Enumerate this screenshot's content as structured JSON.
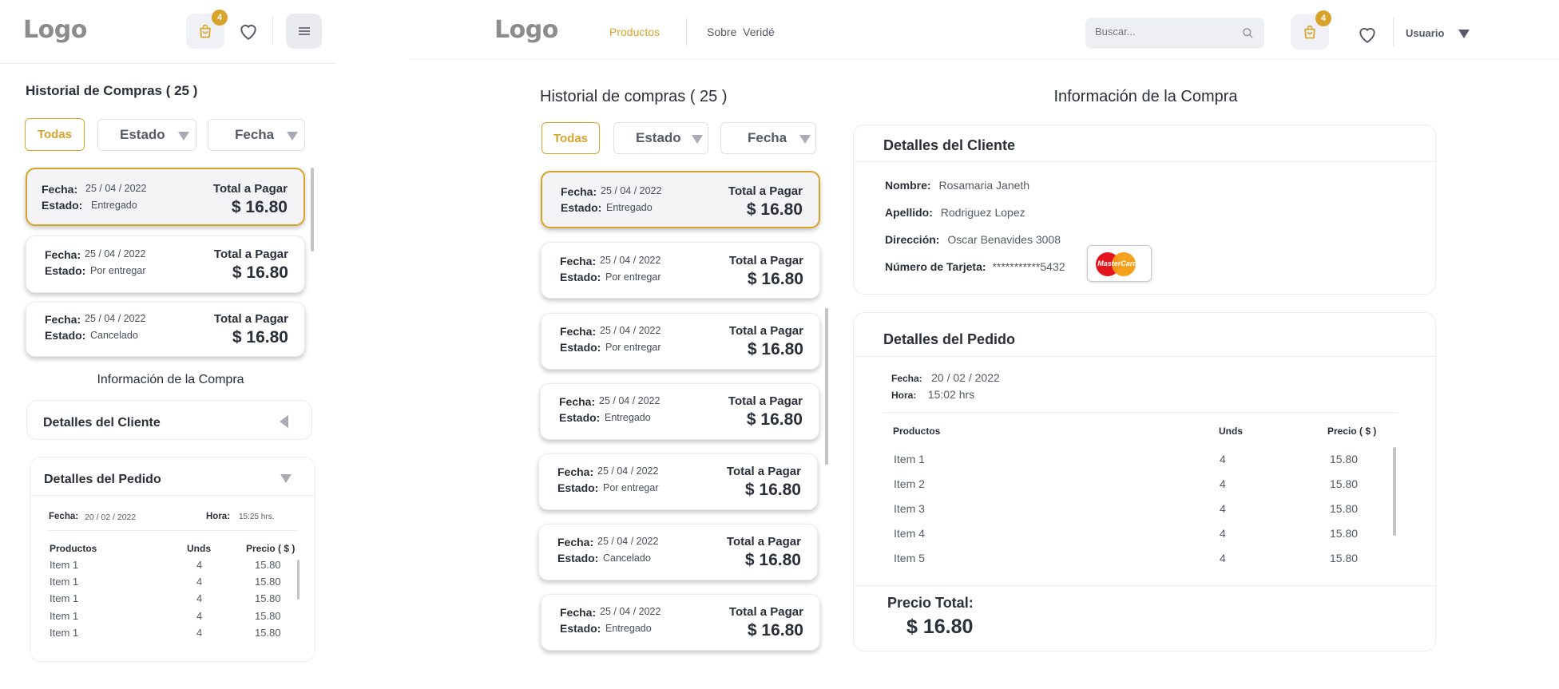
{
  "mobile": {
    "logo": "Logo",
    "cart_badge": "4",
    "history_title": "Historial de Compras ( 25 )",
    "filters": {
      "all": "Todas",
      "status": "Estado",
      "date": "Fecha"
    },
    "orders": [
      {
        "date_label": "Fecha:",
        "date": "25 / 04 / 2022",
        "status_label": "Estado:",
        "status": "Entregado",
        "total_label": "Total a Pagar",
        "amount": "$ 16.80"
      },
      {
        "date_label": "Fecha:",
        "date": "25 / 04 / 2022",
        "status_label": "Estado:",
        "status": "Por entregar",
        "total_label": "Total a Pagar",
        "amount": "$ 16.80"
      },
      {
        "date_label": "Fecha:",
        "date": "25 / 04 / 2022",
        "status_label": "Estado:",
        "status": "Cancelado",
        "total_label": "Total a Pagar",
        "amount": "$ 16.80"
      }
    ],
    "info_title": "Información de la Compra",
    "client_title": "Detalles del Cliente",
    "order_title": "Detalles del Pedido",
    "date_label": "Fecha:",
    "date": "20 / 02 / 2022",
    "time_label": "Hora:",
    "time": "15:25 hrs.",
    "col_products": "Productos",
    "col_units": "Unds",
    "col_price": "Precio ( $ )",
    "items": [
      {
        "name": "Item 1",
        "units": "4",
        "price": "15.80"
      },
      {
        "name": "Item 1",
        "units": "4",
        "price": "15.80"
      },
      {
        "name": "Item 1",
        "units": "4",
        "price": "15.80"
      },
      {
        "name": "Item 1",
        "units": "4",
        "price": "15.80"
      },
      {
        "name": "Item 1",
        "units": "4",
        "price": "15.80"
      }
    ]
  },
  "desktop": {
    "logo": "Logo",
    "nav": {
      "products": "Productos",
      "about": "Sobre  Veridé"
    },
    "search_placeholder": "Buscar...",
    "cart_badge": "4",
    "user": "Usuario",
    "history_title": "Historial de compras ( 25 )",
    "filters": {
      "all": "Todas",
      "status": "Estado",
      "date": "Fecha"
    },
    "orders": [
      {
        "date_label": "Fecha:",
        "date": "25 / 04 / 2022",
        "status_label": "Estado:",
        "status": "Entregado",
        "total_label": "Total a Pagar",
        "amount": "$ 16.80"
      },
      {
        "date_label": "Fecha:",
        "date": "25 / 04 / 2022",
        "status_label": "Estado:",
        "status": "Por entregar",
        "total_label": "Total a Pagar",
        "amount": "$ 16.80"
      },
      {
        "date_label": "Fecha:",
        "date": "25 / 04 / 2022",
        "status_label": "Estado:",
        "status": "Por entregar",
        "total_label": "Total a Pagar",
        "amount": "$ 16.80"
      },
      {
        "date_label": "Fecha:",
        "date": "25 / 04 / 2022",
        "status_label": "Estado:",
        "status": "Entregado",
        "total_label": "Total a Pagar",
        "amount": "$ 16.80"
      },
      {
        "date_label": "Fecha:",
        "date": "25 / 04 / 2022",
        "status_label": "Estado:",
        "status": "Por entregar",
        "total_label": "Total a Pagar",
        "amount": "$ 16.80"
      },
      {
        "date_label": "Fecha:",
        "date": "25 / 04 / 2022",
        "status_label": "Estado:",
        "status": "Cancelado",
        "total_label": "Total a Pagar",
        "amount": "$ 16.80"
      },
      {
        "date_label": "Fecha:",
        "date": "25 / 04 / 2022",
        "status_label": "Estado:",
        "status": "Entregado",
        "total_label": "Total a Pagar",
        "amount": "$ 16.80"
      }
    ],
    "info_title": "Información de la Compra",
    "client": {
      "title": "Detalles del Cliente",
      "name_label": "Nombre:",
      "name": "Rosamaria Janeth",
      "surname_label": "Apellido:",
      "surname": "Rodriguez Lopez",
      "address_label": "Dirección:",
      "address": "Oscar Benavides 3008",
      "card_label": "Número de Tarjeta:",
      "card": "***********5432",
      "card_brand": "MasterCard"
    },
    "order": {
      "title": "Detalles del Pedido",
      "date_label": "Fecha:",
      "date": "20 / 02 / 2022",
      "time_label": "Hora:",
      "time": "15:02 hrs",
      "col_products": "Productos",
      "col_units": "Unds",
      "col_price": "Precio ( $ )",
      "items": [
        {
          "name": "Item 1",
          "units": "4",
          "price": "15.80"
        },
        {
          "name": "Item 2",
          "units": "4",
          "price": "15.80"
        },
        {
          "name": "Item 3",
          "units": "4",
          "price": "15.80"
        },
        {
          "name": "Item 4",
          "units": "4",
          "price": "15.80"
        },
        {
          "name": "Item 5",
          "units": "4",
          "price": "15.80"
        }
      ],
      "total_label": "Precio Total:",
      "total": "$ 16.80"
    }
  },
  "colors": {
    "accent": "#d8a32a",
    "text": "#2b2f3a",
    "muted": "#555a66",
    "border": "#ececf0"
  }
}
